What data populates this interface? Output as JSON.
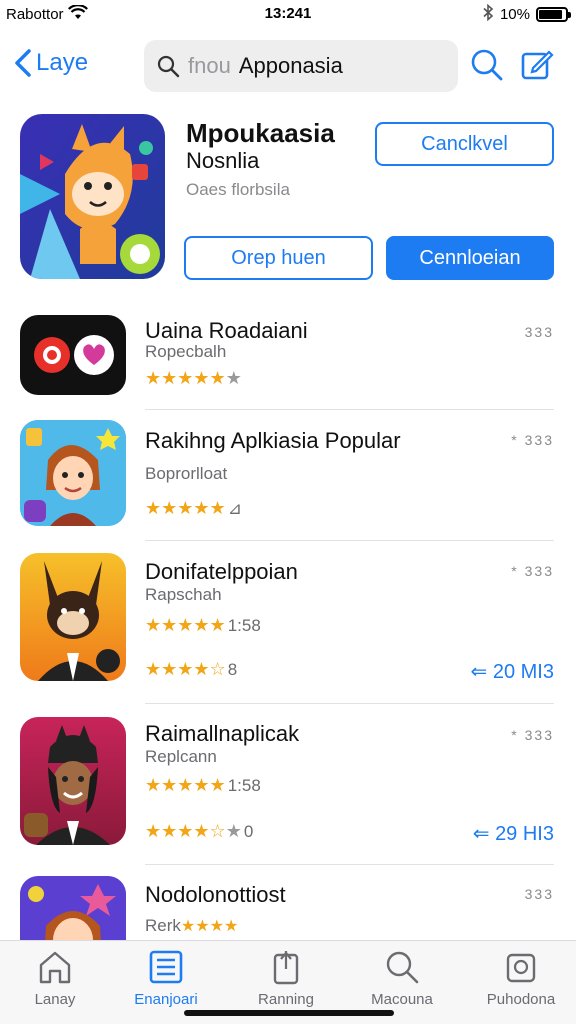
{
  "status": {
    "carrier": "Rabottor",
    "time": "13:241",
    "battery": "10%",
    "battery_level": 0.9
  },
  "nav": {
    "back_label": "Laye",
    "search_placeholder": "fnou",
    "search_value": "Apponasia"
  },
  "featured": {
    "title": "Mpoukaasia",
    "subtitle": "Nosnlia",
    "description": "Oaes florbsila",
    "cancel_label": "Canclkvel",
    "open_label": "Orep huen",
    "download_label": "Cennloeian"
  },
  "apps": [
    {
      "title": "Uaina Roadaiani",
      "subtitle": "Ropecbalh",
      "stars": "★★★★★",
      "extra": "",
      "meta": "333"
    },
    {
      "title": "Rakihng Aplkiasia Popular",
      "subtitle": "Boprorlloat",
      "stars": "★★★★★",
      "extra": "⊿",
      "meta": "* 333"
    },
    {
      "title": "Donifatelppoian",
      "subtitle": "Rapschah",
      "stars": "★★★★★",
      "extra": "1:58",
      "stars2": "★★★★☆",
      "extra2": "8",
      "meta": "* 333",
      "size": "20 MI3"
    },
    {
      "title": "Raimallnaplicak",
      "subtitle": "Replcann",
      "stars": "★★★★★",
      "extra": "1:58",
      "stars2": "★★★★☆",
      "extra2": "0",
      "meta": "* 333",
      "size": "29 HI3"
    },
    {
      "title": "Nodolonottiost",
      "subtitle": "Rerk",
      "stars": "★★★★",
      "extra": "",
      "meta": "333"
    }
  ],
  "tabs": [
    {
      "label": "Lanay"
    },
    {
      "label": "Enanjoari"
    },
    {
      "label": "Ranning"
    },
    {
      "label": "Macouna"
    },
    {
      "label": "Puhodona"
    }
  ],
  "colors": {
    "accent": "#1e7cf2",
    "star": "#f2a516"
  }
}
